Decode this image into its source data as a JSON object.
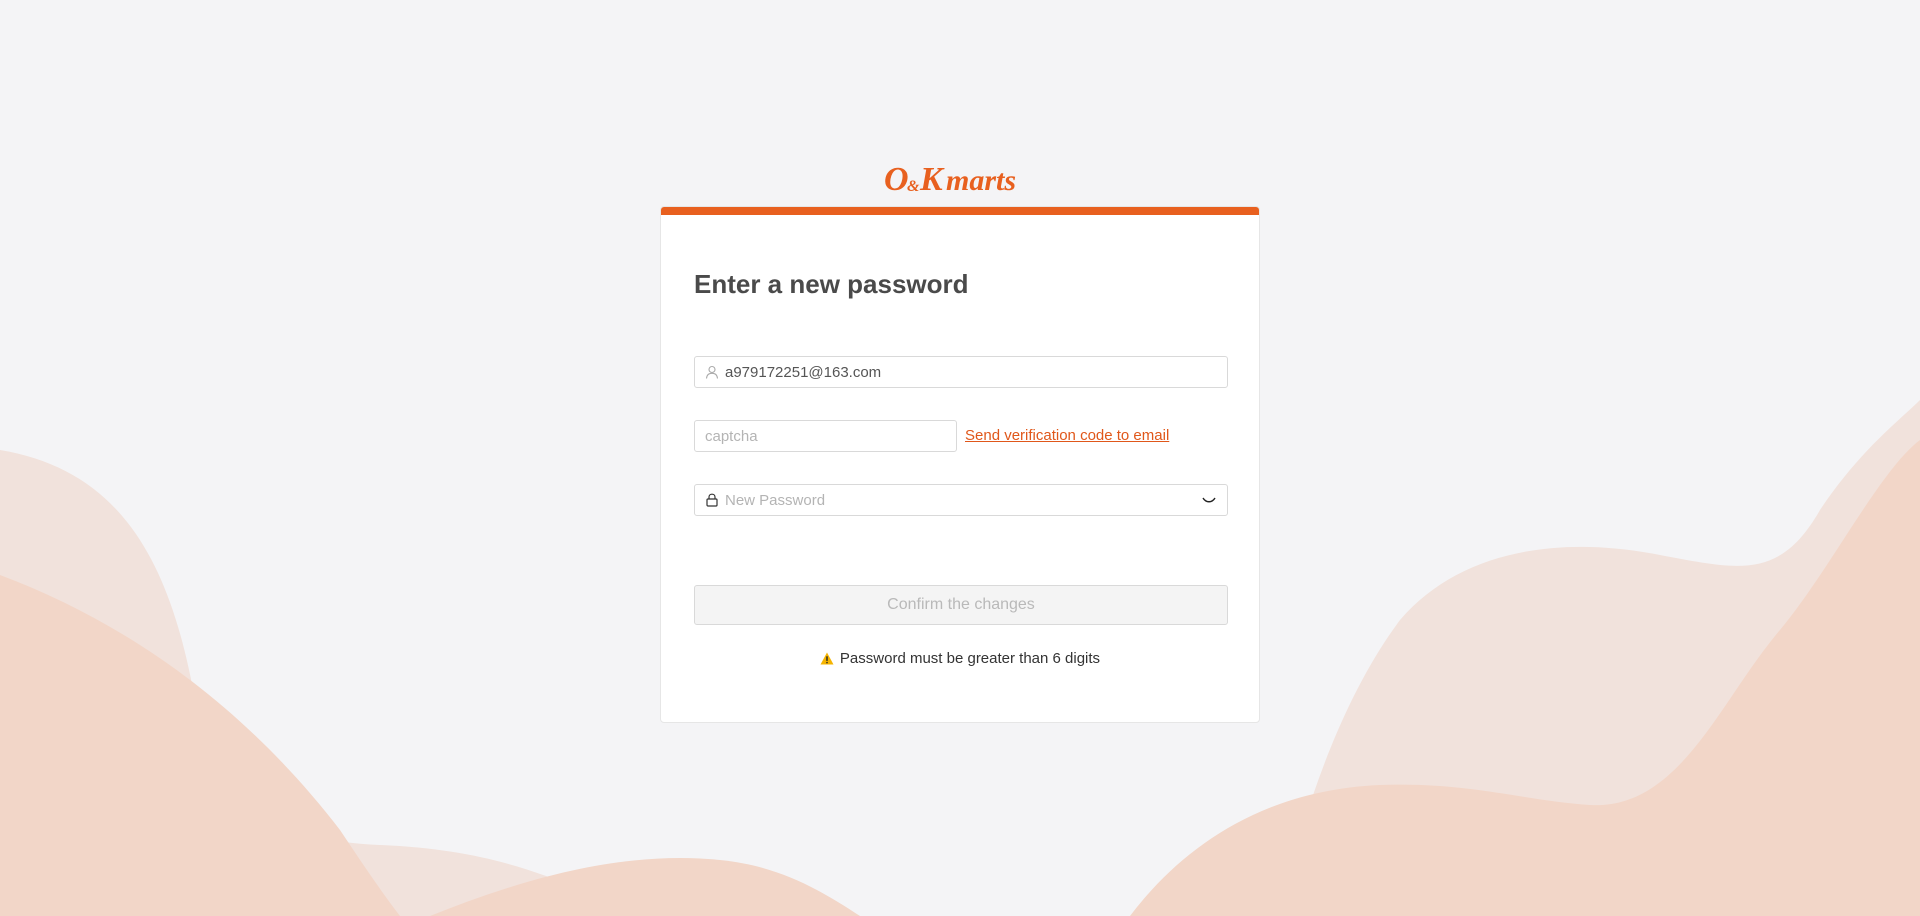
{
  "brand": {
    "logo_text": "O&Kmarts",
    "accent_color": "#e8601f"
  },
  "form": {
    "title": "Enter a new password",
    "email_value": "a979172251@163.com",
    "captcha_placeholder": "captcha",
    "send_code_label": "Send verification code to email",
    "password_placeholder": "New Password",
    "confirm_label": "Confirm the changes",
    "warning_text": "Password must be greater than 6 digits"
  },
  "icons": {
    "email": "user-icon",
    "password": "lock-icon",
    "toggle": "eye-closed-icon",
    "warning": "warning-icon"
  }
}
